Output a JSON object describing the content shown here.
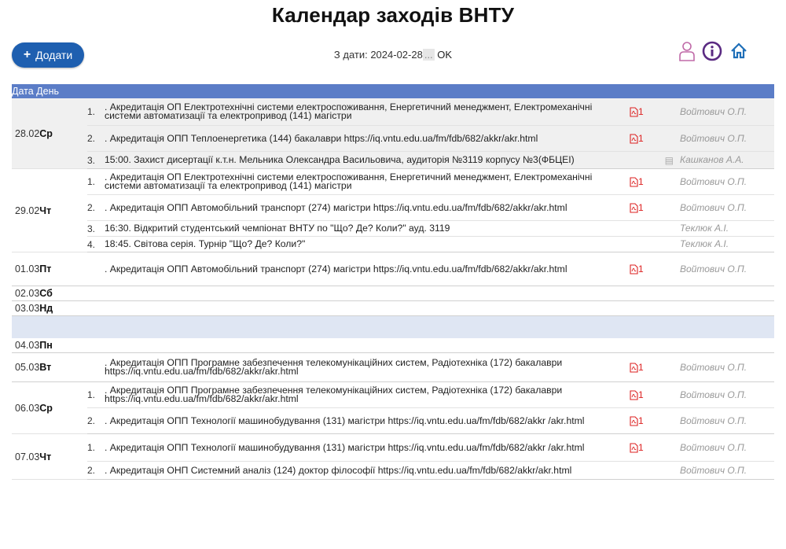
{
  "page": {
    "title": "Календар заходів ВНТУ"
  },
  "toolbar": {
    "add_label": "Додати",
    "filter_prefix": "З дати: ",
    "filter_date": "2024-02-28",
    "filter_dots": "...",
    "ok_label": "OK"
  },
  "icons": {
    "user": "user-icon",
    "info": "info-icon",
    "home": "home-icon",
    "pdf": "pdf-icon",
    "doc": "document-icon"
  },
  "colors": {
    "header": "#5b7dc7",
    "add_button": "#1e5fb0",
    "pdf": "#d22222",
    "icon": "#5a2a82",
    "home": "#1f6fb8"
  },
  "table": {
    "header": "Дата День",
    "days": [
      {
        "date": "28.02",
        "day": "Ср",
        "bg": "gray",
        "events": [
          {
            "n": "1.",
            "text": ". Акредитація ОП Електротехнічні системи електроспоживання, Енергетичний менеджмент, Електромеханічні системи автоматизації та електропривод (141) магістри",
            "pdf": "1",
            "author": "Войтович О.П."
          },
          {
            "n": "2.",
            "text": ". Акредитація ОПП Теплоенергетика (144) бакалаври https://iq.vntu.edu.ua/fm/fdb/682/akkr/akr.html",
            "pdf": "1",
            "author": "Войтович О.П."
          },
          {
            "n": "3.",
            "text": "15:00. Захист дисертації к.т.н. Мельника Олександра Васильовича, аудиторія №3119 корпусу №3(ФБЦЕІ)",
            "doc": true,
            "author": "Кашканов А.А."
          }
        ]
      },
      {
        "date": "29.02",
        "day": "Чт",
        "events": [
          {
            "n": "1.",
            "text": ". Акредитація ОП Електротехнічні системи електроспоживання, Енергетичний менеджмент, Електромеханічні системи автоматизації та електропривод (141) магістри",
            "pdf": "1",
            "author": "Войтович О.П."
          },
          {
            "n": "2.",
            "text": ". Акредитація ОПП Автомобільний транспорт (274) магістри https://iq.vntu.edu.ua/fm/fdb/682/akkr/akr.html",
            "pdf": "1",
            "author": "Войтович О.П."
          },
          {
            "n": "3.",
            "text": "16:30. Відкритий студентський чемпіонат ВНТУ по \"Що? Де? Коли?\" ауд. 3119",
            "author": "Теклюк А.І."
          },
          {
            "n": "4.",
            "text": "18:45. Світова серія. Турнір \"Що? Де? Коли?\"",
            "author": "Теклюк А.І."
          }
        ]
      },
      {
        "date": "01.03",
        "day": "Пт",
        "events": [
          {
            "n": "",
            "text": ". Акредитація ОПП Автомобільний транспорт (274) магістри https://iq.vntu.edu.ua/fm/fdb/682/akkr/akr.html",
            "pdf": "1",
            "author": "Войтович О.П."
          }
        ]
      },
      {
        "date": "02.03",
        "day": "Сб",
        "events": []
      },
      {
        "date": "03.03",
        "day": "Нд",
        "events": []
      },
      {
        "date": "04.03",
        "day": "Пн",
        "events": []
      },
      {
        "date": "05.03",
        "day": "Вт",
        "events": [
          {
            "n": "",
            "text": ". Акредитація ОПП Програмне забезпечення телекомунікаційних систем, Радіотехніка (172) бакалаври https://iq.vntu.edu.ua/fm/fdb/682/akkr/akr.html",
            "pdf": "1",
            "author": "Войтович О.П."
          }
        ]
      },
      {
        "date": "06.03",
        "day": "Ср",
        "events": [
          {
            "n": "1.",
            "text": ". Акредитація ОПП Програмне забезпечення телекомунікаційних систем, Радіотехніка (172) бакалаври https://iq.vntu.edu.ua/fm/fdb/682/akkr/akr.html",
            "pdf": "1",
            "author": "Войтович О.П."
          },
          {
            "n": "2.",
            "text": ". Акредитація ОПП Технології машинобудування (131) магістри https://iq.vntu.edu.ua/fm/fdb/682/akkr /akr.html",
            "pdf": "1",
            "author": "Войтович О.П."
          }
        ]
      },
      {
        "date": "07.03",
        "day": "Чт",
        "events": [
          {
            "n": "1.",
            "text": ". Акредитація ОПП Технології машинобудування (131) магістри https://iq.vntu.edu.ua/fm/fdb/682/akkr /akr.html",
            "pdf": "1",
            "author": "Войтович О.П."
          },
          {
            "n": "2.",
            "text": ". Акредитація ОНП Системний аналіз (124) доктор філософії https://iq.vntu.edu.ua/fm/fdb/682/akkr/akr.html",
            "author": "Войтович О.П."
          }
        ]
      }
    ]
  }
}
